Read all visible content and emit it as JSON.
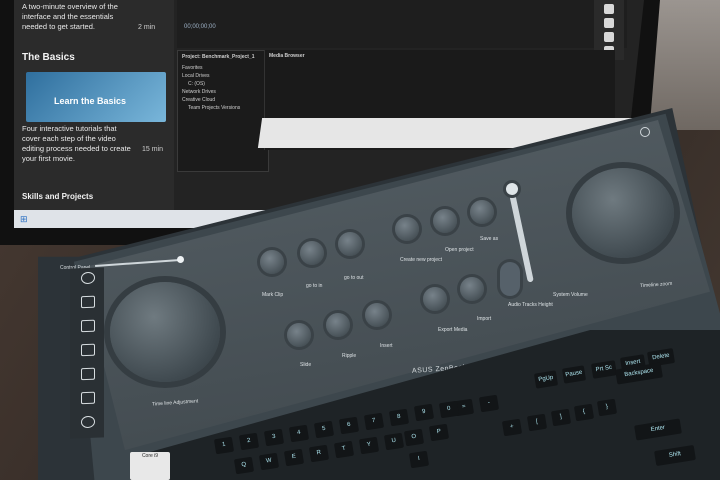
{
  "screen": {
    "lesson_description": "A two-minute overview of the interface and the essentials needed to get started.",
    "lesson_duration": "2 min",
    "section_title": "The Basics",
    "thumbnail_caption": "Learn the Basics",
    "basics_description": "Four interactive tutorials that cover each step of the video editing process needed to create your first movie.",
    "basics_duration": "15 min",
    "next_section": "Skills and Projects",
    "timecode": "00;00;00;00",
    "project_tab": "Project: Benchmark_Project_1",
    "media_browser_tab": "Media Browser",
    "project_rows": [
      "Favorites",
      "Local Drives",
      "C: (OS)",
      "Network Drives",
      "Creative Cloud",
      "Team Projects Versions"
    ]
  },
  "control_panel": {
    "title": "Control Panel",
    "dial_left_label": "Time line Adjustment",
    "dial_right_label": "Timeline zoom",
    "buttons": [
      {
        "label": "Mark Clip"
      },
      {
        "label": "go to in"
      },
      {
        "label": "go to out"
      },
      {
        "label": "Create new project"
      },
      {
        "label": "Open project"
      },
      {
        "label": "Save as"
      },
      {
        "label": "Slide"
      },
      {
        "label": "Ripple"
      },
      {
        "label": "Insert"
      },
      {
        "label": "Export Media"
      },
      {
        "label": "Import"
      },
      {
        "label": "Audio Tracks Height"
      },
      {
        "label": "System Volume"
      }
    ]
  },
  "brand": "ASUS ZenBook",
  "keyboard": {
    "keys": [
      "PgUp",
      "Pause",
      "Prt Sc",
      "Insert",
      "Delete",
      "Backspace",
      "Enter",
      "Shift",
      "=",
      "-",
      "+",
      "[",
      "]",
      "{",
      "}",
      "P",
      "O",
      "9",
      "0",
      "8",
      "7",
      "6",
      "5",
      "4",
      "3",
      "2",
      "1",
      "Q",
      "W",
      "E",
      "R",
      "T",
      "Y",
      "U",
      "I"
    ]
  },
  "sticker": "Core i9"
}
